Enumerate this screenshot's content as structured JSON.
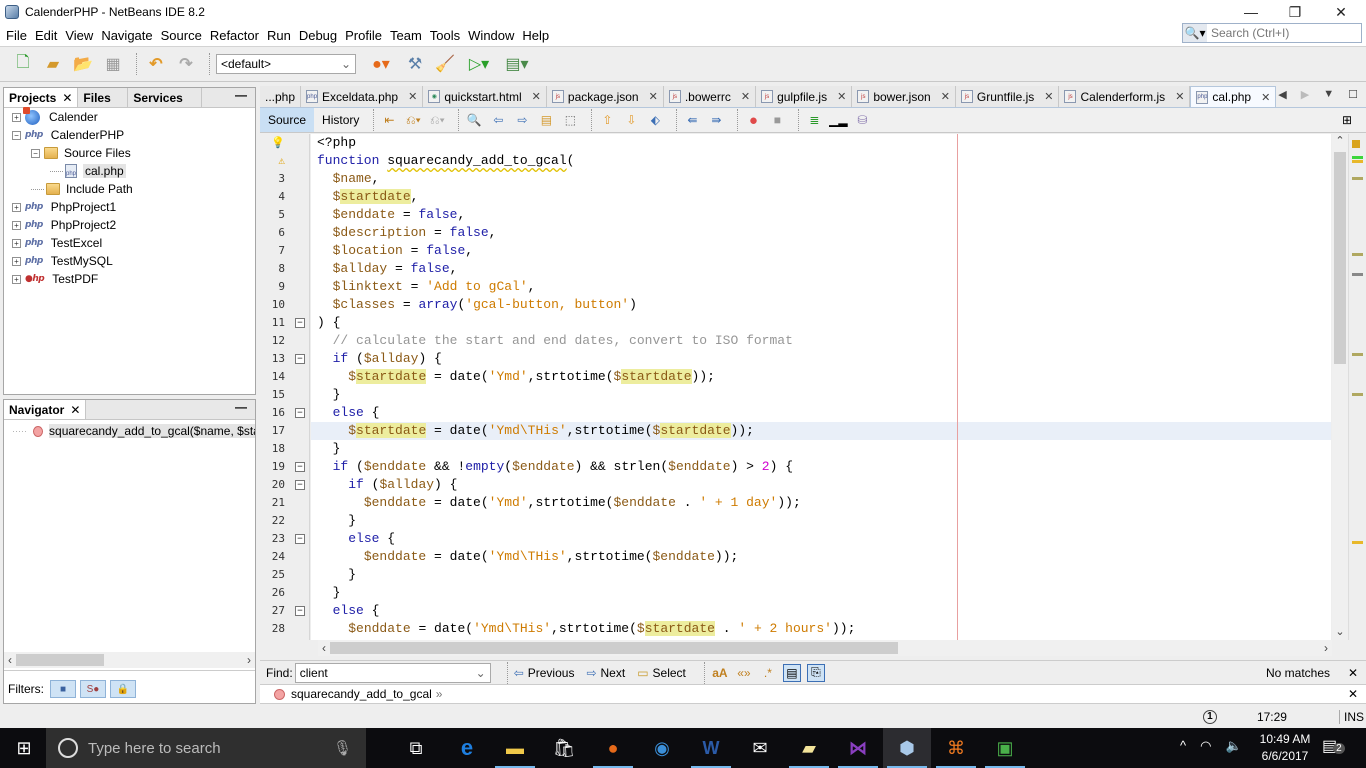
{
  "window": {
    "title": "CalenderPHP - NetBeans IDE 8.2",
    "minimize": "—",
    "restore": "❐",
    "close": "✕"
  },
  "menu": [
    "File",
    "Edit",
    "View",
    "Navigate",
    "Source",
    "Refactor",
    "Run",
    "Debug",
    "Profile",
    "Team",
    "Tools",
    "Window",
    "Help"
  ],
  "search": {
    "placeholder": "Search (Ctrl+I)"
  },
  "toolbar": {
    "config": "<default>"
  },
  "projects_panel": {
    "tabs": [
      "Projects",
      "Files",
      "Services"
    ],
    "tree": [
      {
        "label": "Calender",
        "type": "html5",
        "level": 0,
        "expanded": false
      },
      {
        "label": "CalenderPHP",
        "type": "php",
        "level": 0,
        "expanded": true
      },
      {
        "label": "Source Files",
        "type": "folder",
        "level": 1,
        "expanded": true
      },
      {
        "label": "cal.php",
        "type": "file",
        "level": 2,
        "selected": true
      },
      {
        "label": "Include Path",
        "type": "folder",
        "level": 1
      },
      {
        "label": "PhpProject1",
        "type": "php",
        "level": 0,
        "expanded": false
      },
      {
        "label": "PhpProject2",
        "type": "php",
        "level": 0,
        "expanded": false
      },
      {
        "label": "TestExcel",
        "type": "php",
        "level": 0,
        "expanded": false
      },
      {
        "label": "TestMySQL",
        "type": "php",
        "level": 0,
        "expanded": false
      },
      {
        "label": "TestPDF",
        "type": "php-error",
        "level": 0,
        "expanded": false
      }
    ]
  },
  "navigator": {
    "title": "Navigator",
    "item": "squarecandy_add_to_gcal($name, $startda",
    "filters_label": "Filters:"
  },
  "editor": {
    "tabs": [
      {
        "label": "...php",
        "icon": "php"
      },
      {
        "label": "Exceldata.php",
        "icon": "php"
      },
      {
        "label": "quickstart.html",
        "icon": "html"
      },
      {
        "label": "package.json",
        "icon": "js"
      },
      {
        "label": ".bowerrc",
        "icon": "js"
      },
      {
        "label": "gulpfile.js",
        "icon": "js"
      },
      {
        "label": "bower.json",
        "icon": "js"
      },
      {
        "label": "Gruntfile.js",
        "icon": "js"
      },
      {
        "label": "Calenderform.js",
        "icon": "js"
      },
      {
        "label": "cal.php",
        "icon": "php",
        "active": true
      }
    ],
    "modes": [
      "Source",
      "History"
    ],
    "current_line": 17,
    "lines": [
      {
        "n": "",
        "g": "bulb",
        "html": "<?php"
      },
      {
        "n": "",
        "g": "warn",
        "html": "<span class='kw'>function</span> <span class='fn'>squarecandy_add_to_gcal</span>("
      },
      {
        "n": "3",
        "html": "  <span class='var'>$name</span>,"
      },
      {
        "n": "4",
        "html": "  <span class='var'>$<span class='hl'>startdate</span></span>,"
      },
      {
        "n": "5",
        "html": "  <span class='var'>$enddate</span> = <span class='kw'>false</span>,"
      },
      {
        "n": "6",
        "html": "  <span class='var'>$description</span> = <span class='kw'>false</span>,"
      },
      {
        "n": "7",
        "html": "  <span class='var'>$location</span> = <span class='kw'>false</span>,"
      },
      {
        "n": "8",
        "html": "  <span class='var'>$allday</span> = <span class='kw'>false</span>,"
      },
      {
        "n": "9",
        "html": "  <span class='var'>$linktext</span> = <span class='str'>'Add to gCal'</span>,"
      },
      {
        "n": "10",
        "html": "  <span class='var'>$classes</span> = <span class='kw'>array</span>(<span class='str'>'gcal-button, button'</span>)"
      },
      {
        "n": "11",
        "f": "−",
        "html": ") {"
      },
      {
        "n": "12",
        "html": "  <span class='cmt'>// calculate the start and end dates, convert to ISO format</span>"
      },
      {
        "n": "13",
        "f": "−",
        "html": "  <span class='kw'>if</span> (<span class='var'>$allday</span>) {"
      },
      {
        "n": "14",
        "html": "    <span class='var'>$<span class='hl'>startdate</span></span> = date(<span class='str'>'Ymd'</span>,strtotime(<span class='var'>$<span class='hl'>startdate</span></span>));"
      },
      {
        "n": "15",
        "html": "  }"
      },
      {
        "n": "16",
        "f": "−",
        "html": "  <span class='kw'>else</span> {"
      },
      {
        "n": "17",
        "html": "    <span class='var'>$<span class='hl'>startdate</span></span> = date(<span class='str'>'Ymd\\THis'</span>,strtotime(<span class='var'>$<span class='hl'>startdate</span></span>));"
      },
      {
        "n": "18",
        "html": "  }"
      },
      {
        "n": "19",
        "f": "−",
        "html": "  <span class='kw'>if</span> (<span class='var'>$enddate</span> &amp;&amp; !<span class='kw'>empty</span>(<span class='var'>$enddate</span>) &amp;&amp; strlen(<span class='var'>$enddate</span>) &gt; <span class='num'>2</span>) {"
      },
      {
        "n": "20",
        "f": "−",
        "html": "    <span class='kw'>if</span> (<span class='var'>$allday</span>) {"
      },
      {
        "n": "21",
        "html": "      <span class='var'>$enddate</span> = date(<span class='str'>'Ymd'</span>,strtotime(<span class='var'>$enddate</span> . <span class='str'>' + 1 day'</span>));"
      },
      {
        "n": "22",
        "html": "    }"
      },
      {
        "n": "23",
        "f": "−",
        "html": "    <span class='kw'>else</span> {"
      },
      {
        "n": "24",
        "html": "      <span class='var'>$enddate</span> = date(<span class='str'>'Ymd\\THis'</span>,strtotime(<span class='var'>$enddate</span>));"
      },
      {
        "n": "25",
        "html": "    }"
      },
      {
        "n": "26",
        "html": "  }"
      },
      {
        "n": "27",
        "f": "−",
        "html": "  <span class='kw'>else</span> {"
      },
      {
        "n": "28",
        "html": "    <span class='var'>$enddate</span> = date(<span class='str'>'Ymd\\THis'</span>,strtotime(<span class='var'>$<span class='hl'>startdate</span></span> . <span class='str'>' + 2 hours'</span>));"
      }
    ]
  },
  "find": {
    "label": "Find:",
    "value": "client",
    "previous": "Previous",
    "next": "Next",
    "select": "Select",
    "status": "No matches"
  },
  "breadcrumb": {
    "item": "squarecandy_add_to_gcal"
  },
  "status": {
    "notifications": "1",
    "position": "17:29",
    "mode": "INS"
  },
  "taskbar": {
    "search_placeholder": "Type here to search",
    "time": "10:49 AM",
    "date": "6/6/2017",
    "notif_count": "2"
  }
}
